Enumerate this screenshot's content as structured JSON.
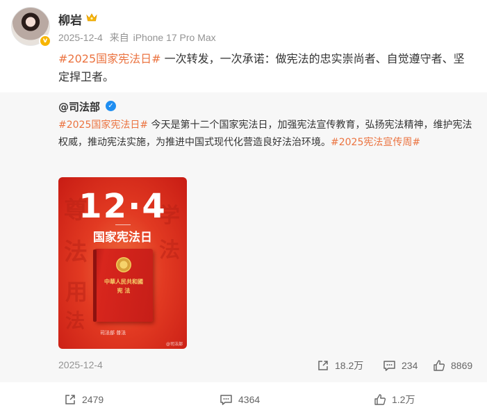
{
  "post": {
    "author": "柳岩",
    "meta": {
      "date": "2025-12-4",
      "source_prefix": "来自",
      "device": "iPhone 17 Pro Max"
    },
    "text": {
      "hashtag": "#2025国家宪法日#",
      "body": " 一次转发，一次承诺：做宪法的忠实崇尚者、自觉遵守者、坚定捍卫者。"
    }
  },
  "repost": {
    "author": "@司法部",
    "text": {
      "hashtag1": "#2025国家宪法日#",
      "body": " 今天是第十二个国家宪法日，加强宪法宣传教育，弘扬宪法精神，维护宪法权威，推动宪法实施，为推进中国式现代化营造良好法治环境。",
      "hashtag2": "#2025宪法宣传周#"
    },
    "poster": {
      "date": "12·4",
      "title": "国家宪法日",
      "book_line1": "中華人民共和國",
      "book_line2": "宪 法",
      "bg_chars": [
        "尊",
        "法",
        "用",
        "法",
        "学",
        "法"
      ],
      "logos": "司法部  普法",
      "watermark": "@司法部"
    },
    "date": "2025-12-4",
    "stats": {
      "reposts": "18.2万",
      "comments": "234",
      "likes": "8869"
    }
  },
  "actions": {
    "repost_count": "2479",
    "comment_count": "4364",
    "like_count": "1.2万"
  },
  "colors": {
    "hashtag": "#eb7340",
    "meta": "#939393",
    "card_bg": "#f7f7f7",
    "verified_gold": "#f7b500",
    "verified_blue": "#1f8ef1"
  },
  "icons": {
    "repost": "repost-icon",
    "comment": "comment-icon",
    "like": "like-icon",
    "crown": "crown-icon"
  }
}
